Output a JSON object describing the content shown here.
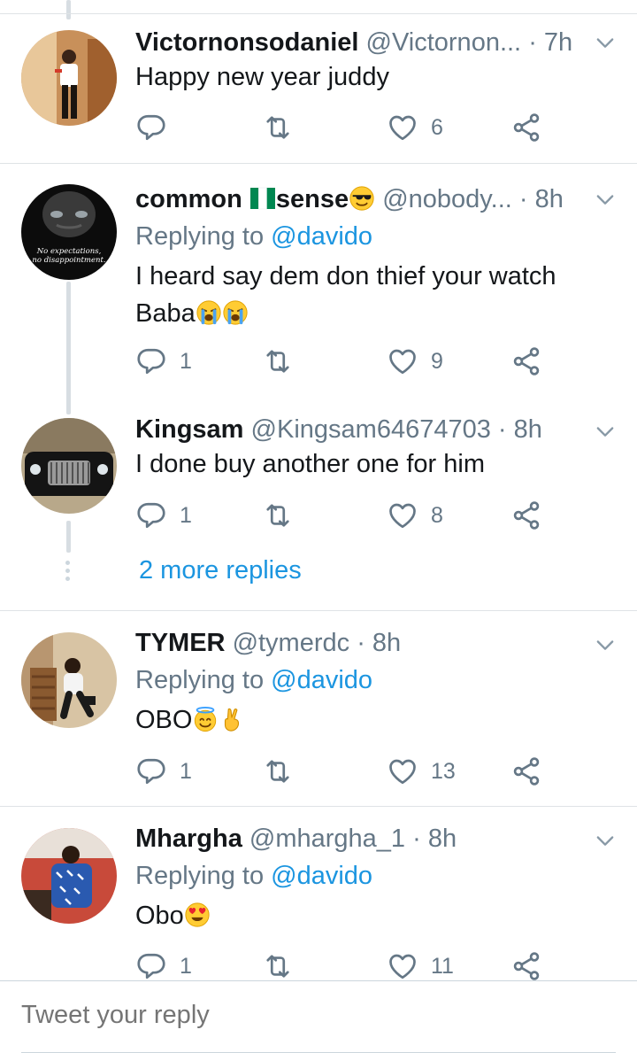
{
  "tweets": [
    {
      "name": "Victornonsodaniel",
      "handle": "@Victornon...",
      "time": "· 7h",
      "text": "Happy new year juddy",
      "reply_count": "",
      "like_count": "6"
    },
    {
      "name": "common",
      "name_suffix": "sense",
      "handle": "@nobody...",
      "time": "· 8h",
      "replying_prefix": "Replying to",
      "replying_mention": "@davido",
      "text": "I heard say dem don thief your watch Baba",
      "avatar_caption_1": "No expectations,",
      "avatar_caption_2": "no disappointment.",
      "reply_count": "1",
      "like_count": "9"
    },
    {
      "name": "Kingsam",
      "handle": "@Kingsam64674703",
      "time": "· 8h",
      "text": "I done buy another one for him",
      "reply_count": "1",
      "like_count": "8"
    },
    {
      "name": "TYMER",
      "handle": "@tymerdc",
      "time": "· 8h",
      "replying_prefix": "Replying to",
      "replying_mention": "@davido",
      "text": "OBO",
      "reply_count": "1",
      "like_count": "13"
    },
    {
      "name": "Mhargha",
      "handle": "@mhargha_1",
      "time": "· 8h",
      "replying_prefix": "Replying to",
      "replying_mention": "@davido",
      "text": "Obo",
      "reply_count": "1",
      "like_count": "11"
    }
  ],
  "more_replies": "2 more replies",
  "composer": {
    "placeholder": "Tweet your reply"
  },
  "colors": {
    "text": "#14171a",
    "secondary": "#657786",
    "link": "#1b95e0",
    "divider": "#dfe3e6",
    "thread_line": "#d7dde2"
  },
  "icons": [
    "reply-icon",
    "retweet-icon",
    "like-icon",
    "share-icon",
    "chevron-down-icon"
  ]
}
